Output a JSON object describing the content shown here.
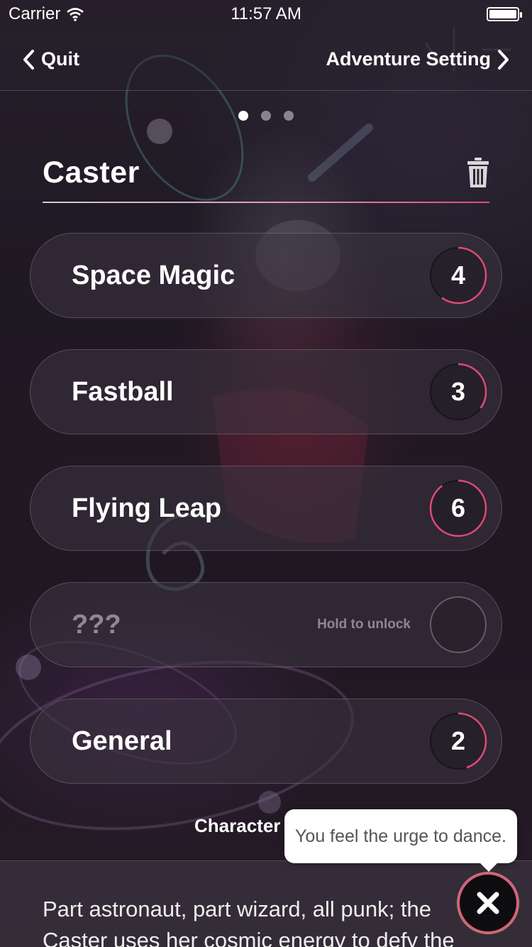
{
  "status_bar": {
    "carrier": "Carrier",
    "time": "11:57 AM"
  },
  "nav": {
    "back_label": "Quit",
    "forward_label": "Adventure Setting"
  },
  "pager": {
    "count": 3,
    "active_index": 0
  },
  "class": {
    "title": "Caster"
  },
  "skills": [
    {
      "label": "Space Magic",
      "value": "4",
      "progress": 0.6,
      "locked": false
    },
    {
      "label": "Fastball",
      "value": "3",
      "progress": 0.35,
      "locked": false
    },
    {
      "label": "Flying Leap",
      "value": "6",
      "progress": 0.9,
      "locked": false
    },
    {
      "label": "???",
      "value": "",
      "hint": "Hold to unlock",
      "progress": 0,
      "locked": true
    },
    {
      "label": "General",
      "value": "2",
      "progress": 0.45,
      "locked": false
    }
  ],
  "character_label": "Character",
  "tooltip": {
    "text": "You feel the urge to dance."
  },
  "description": {
    "text": "Part astronaut, part wizard, all punk; the Caster uses her cosmic energy to defy the"
  },
  "colors": {
    "accent": "#e04a78",
    "panel": "#3c3442"
  },
  "icons": {
    "back": "chevron-left-icon",
    "forward": "chevron-right-icon",
    "delete": "trash-icon",
    "close": "close-icon",
    "wifi": "wifi-icon",
    "battery": "battery-icon"
  }
}
